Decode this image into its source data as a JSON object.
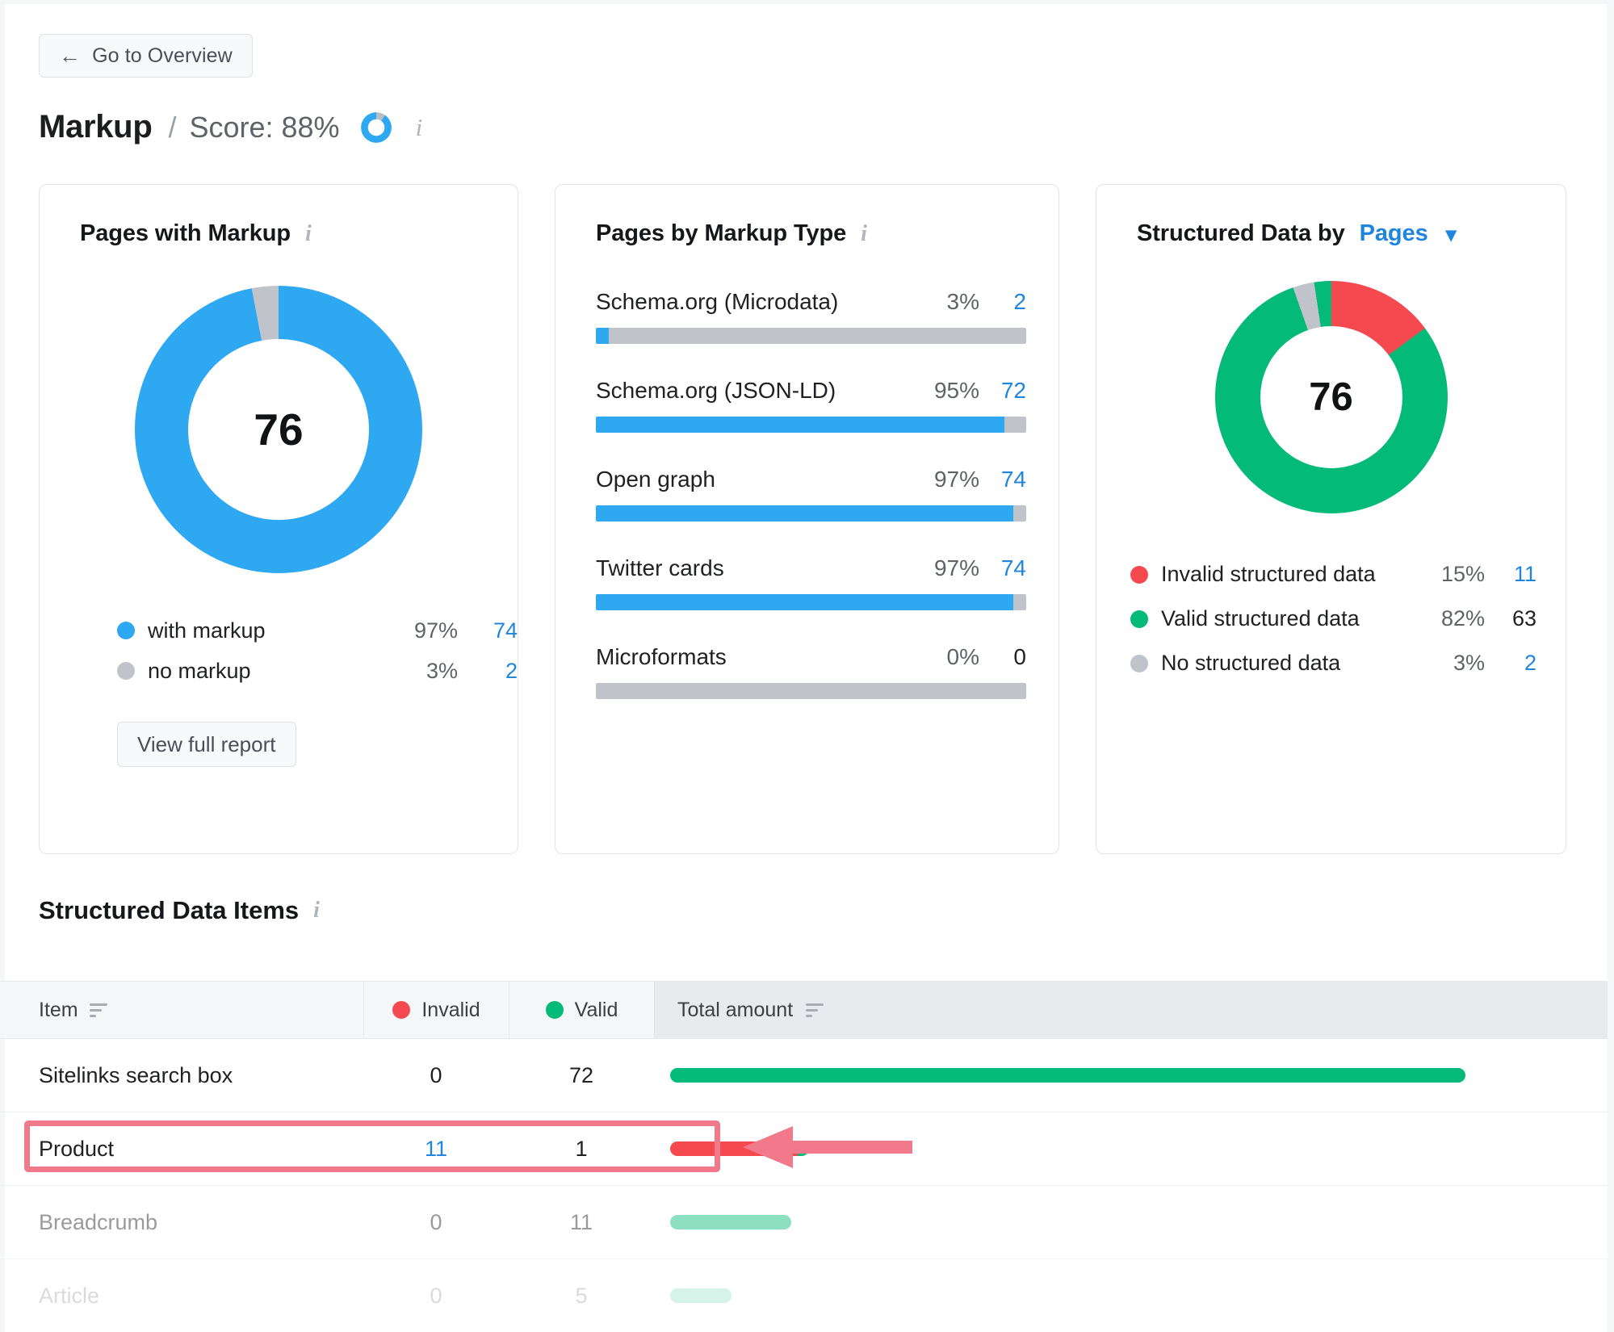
{
  "header": {
    "overview_button": "Go to Overview",
    "back_icon": "arrow-left-icon",
    "title": "Markup",
    "separator": "/",
    "score_label": "Score: 88%",
    "score_percent": 88,
    "info_icon": "info-icon"
  },
  "card_pages_with_markup": {
    "title": "Pages with Markup",
    "center_value": "76",
    "legend": [
      {
        "label": "with markup",
        "percent": "97%",
        "value": "74",
        "color": "#2ea8f0"
      },
      {
        "label": "no markup",
        "percent": "3%",
        "value": "2",
        "color": "#c0c4ca"
      }
    ],
    "button": "View full report"
  },
  "card_pages_by_markup_type": {
    "title": "Pages by Markup Type",
    "rows": [
      {
        "label": "Schema.org (Microdata)",
        "percent": "3%",
        "value": "2",
        "fill": 3
      },
      {
        "label": "Schema.org (JSON-LD)",
        "percent": "95%",
        "value": "72",
        "fill": 95
      },
      {
        "label": "Open graph",
        "percent": "97%",
        "value": "74",
        "fill": 97
      },
      {
        "label": "Twitter cards",
        "percent": "97%",
        "value": "74",
        "fill": 97
      },
      {
        "label": "Microformats",
        "percent": "0%",
        "value": "0",
        "fill": 0
      }
    ]
  },
  "card_structured_data_by": {
    "title_prefix": "Structured Data by",
    "selected": "Pages",
    "chevron_icon": "chevron-down-icon",
    "center_value": "76",
    "legend": [
      {
        "label": "Invalid structured data",
        "percent": "15%",
        "value": "11",
        "color": "#f4494f"
      },
      {
        "label": "Valid structured data",
        "percent": "82%",
        "value": "63",
        "color": "#03ba78"
      },
      {
        "label": "No structured data",
        "percent": "3%",
        "value": "2",
        "color": "#c0c4ca"
      }
    ]
  },
  "structured_data_items": {
    "title": "Structured Data Items",
    "columns": {
      "item": "Item",
      "invalid": "Invalid",
      "valid": "Valid",
      "total": "Total amount"
    },
    "rows": [
      {
        "item": "Sitelinks search box",
        "invalid": "0",
        "valid": "72",
        "invalid_w": 0,
        "valid_w": 100
      },
      {
        "item": "Product",
        "invalid": "11",
        "valid": "1",
        "invalid_w": 92,
        "valid_w": 8
      },
      {
        "item": "Breadcrumb",
        "invalid": "0",
        "valid": "11",
        "invalid_w": 0,
        "valid_w": 100
      },
      {
        "item": "Article",
        "invalid": "0",
        "valid": "5",
        "invalid_w": 0,
        "valid_w": 100
      }
    ]
  },
  "annotation": {
    "highlight_color": "#f2798c",
    "arrow_color": "#f2798c",
    "highlight_target": "Product"
  },
  "chart_data": [
    {
      "type": "pie",
      "title": "Pages with Markup",
      "center_label": "76",
      "labels": [
        "with markup",
        "no markup"
      ],
      "values": [
        74,
        2
      ],
      "percents": [
        97,
        3
      ],
      "colors": [
        "#2ea8f0",
        "#c0c4ca"
      ],
      "legend": "bottom"
    },
    {
      "type": "bar",
      "title": "Pages by Markup Type",
      "orientation": "horizontal",
      "categories": [
        "Schema.org (Microdata)",
        "Schema.org (JSON-LD)",
        "Open graph",
        "Twitter cards",
        "Microformats"
      ],
      "values": [
        2,
        72,
        74,
        74,
        0
      ],
      "percents": [
        3,
        95,
        97,
        97,
        0
      ],
      "xlabel": "",
      "ylabel": "",
      "xlim": [
        0,
        100
      ],
      "colors": [
        "#2ea8f0"
      ],
      "track_color": "#c0c4ca",
      "grid": false
    },
    {
      "type": "pie",
      "title": "Structured Data by Pages",
      "center_label": "76",
      "labels": [
        "Invalid structured data",
        "Valid structured data",
        "No structured data"
      ],
      "values": [
        11,
        63,
        2
      ],
      "percents": [
        15,
        82,
        3
      ],
      "colors": [
        "#f4494f",
        "#03ba78",
        "#c0c4ca"
      ],
      "legend": "bottom"
    },
    {
      "type": "table",
      "title": "Structured Data Items",
      "columns": [
        "Item",
        "Invalid",
        "Valid",
        "Total amount"
      ],
      "rows": [
        [
          "Sitelinks search box",
          0,
          72,
          72
        ],
        [
          "Product",
          11,
          1,
          12
        ],
        [
          "Breadcrumb",
          0,
          11,
          11
        ],
        [
          "Article",
          0,
          5,
          5
        ]
      ]
    }
  ]
}
